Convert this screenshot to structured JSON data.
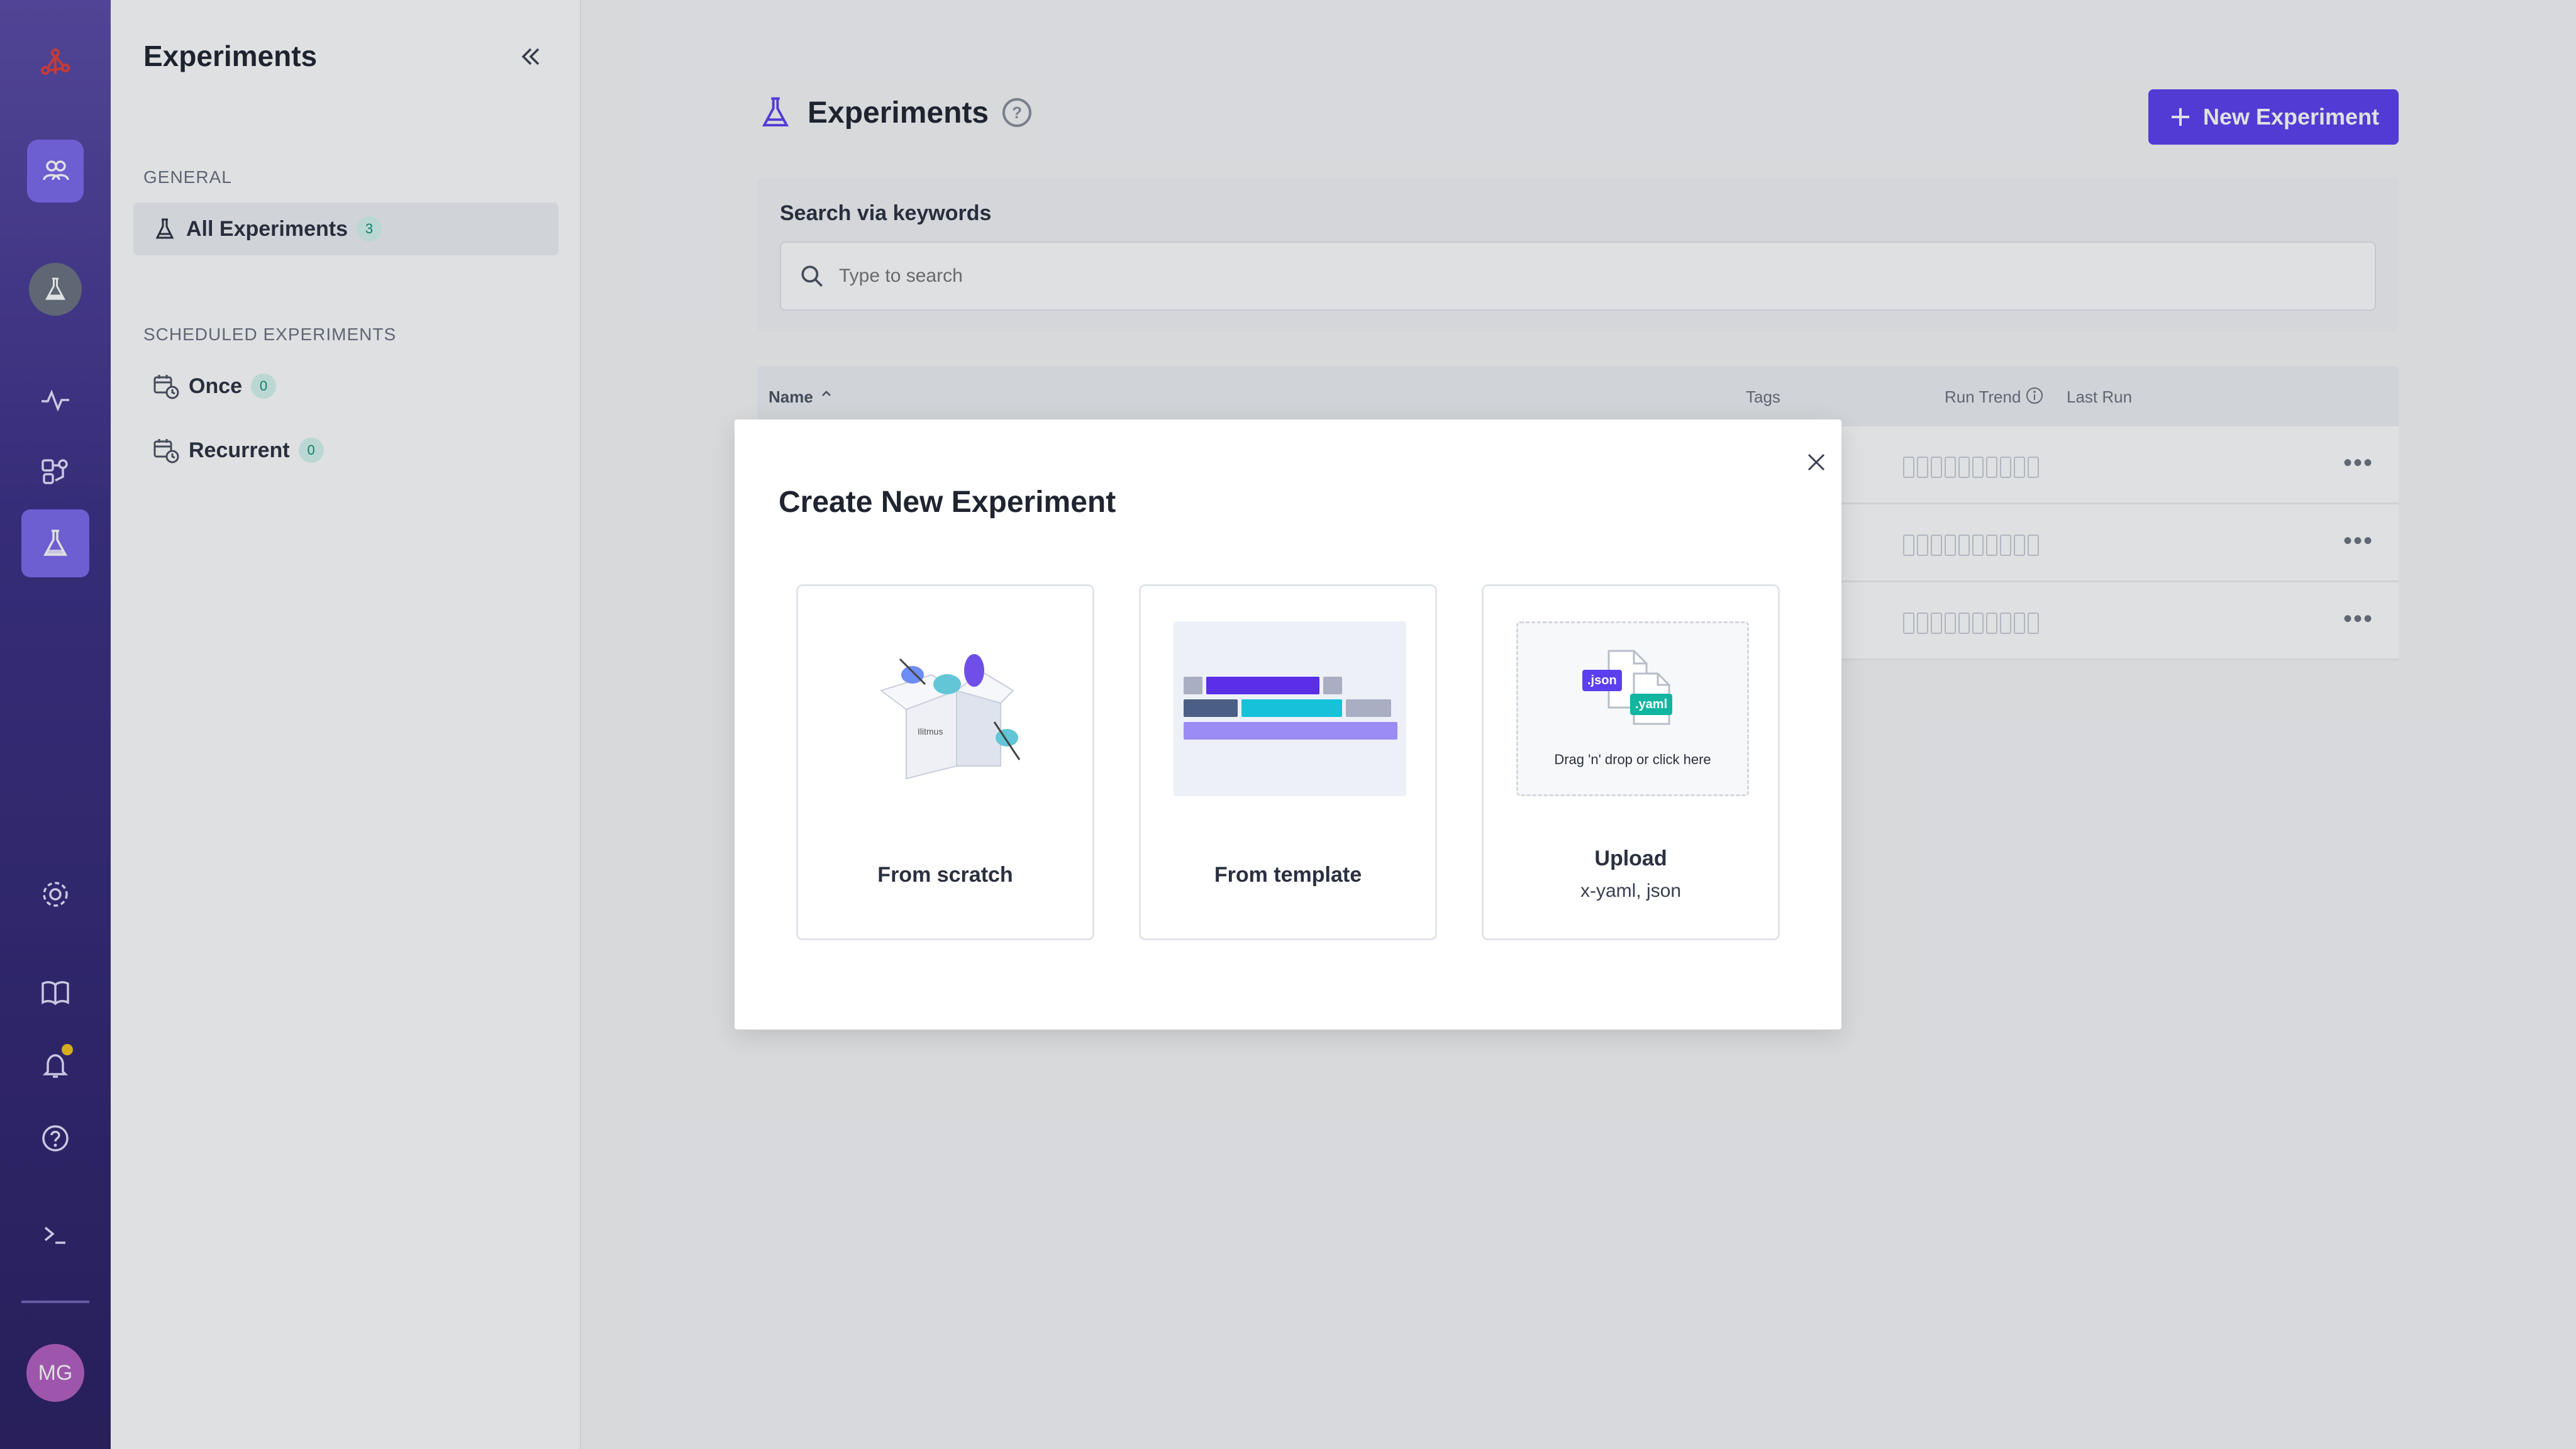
{
  "sidebar": {
    "title": "Experiments",
    "sections": [
      {
        "label": "GENERAL",
        "items": [
          {
            "label": "All Experiments",
            "count": "3"
          }
        ]
      },
      {
        "label": "SCHEDULED EXPERIMENTS",
        "items": [
          {
            "label": "Once",
            "count": "0"
          },
          {
            "label": "Recurrent",
            "count": "0"
          }
        ]
      }
    ]
  },
  "rail": {
    "avatar_initials": "MG"
  },
  "main": {
    "title": "Experiments",
    "help_glyph": "?",
    "new_button_label": "New Experiment",
    "search": {
      "label": "Search via keywords",
      "placeholder": "Type to search"
    },
    "table": {
      "columns": [
        "Name",
        "Tags",
        "Run Trend",
        "Last Run"
      ],
      "row_menu_glyph": "•••"
    }
  },
  "modal": {
    "title": "Create New Experiment",
    "options": [
      {
        "label": "From scratch"
      },
      {
        "label": "From template"
      },
      {
        "label": "Upload",
        "sublabel": "x-yaml, json",
        "drop_text": "Drag 'n' drop or click here",
        "badges": [
          ".json",
          ".yaml"
        ]
      }
    ],
    "illustration_text": "Ilitmus"
  },
  "colors": {
    "accent": "#5b3ff0",
    "rail_top": "#5a4aa8",
    "rail_bottom": "#2a1f63",
    "count_badge_bg": "#d6f5ef",
    "count_badge_fg": "#0f8c76",
    "json_badge": "#5b3ff0",
    "yaml_badge": "#11b5a0"
  },
  "icons": {
    "rail": [
      "litmus-logo-icon",
      "collaborators-icon",
      "experiment-flask-icon",
      "activity-icon",
      "chaos-hub-icon",
      "experiments-flask-icon",
      "settings-gear-icon",
      "docs-book-icon",
      "notification-bell-icon",
      "help-icon",
      "terminal-icon"
    ],
    "sidebar": [
      "collapse-double-chevron-icon",
      "flask-icon",
      "calendar-clock-icon"
    ],
    "main": [
      "flask-icon",
      "help-icon",
      "plus-icon",
      "search-icon",
      "sort-caret-icon",
      "info-icon"
    ],
    "modal": [
      "close-icon"
    ]
  }
}
